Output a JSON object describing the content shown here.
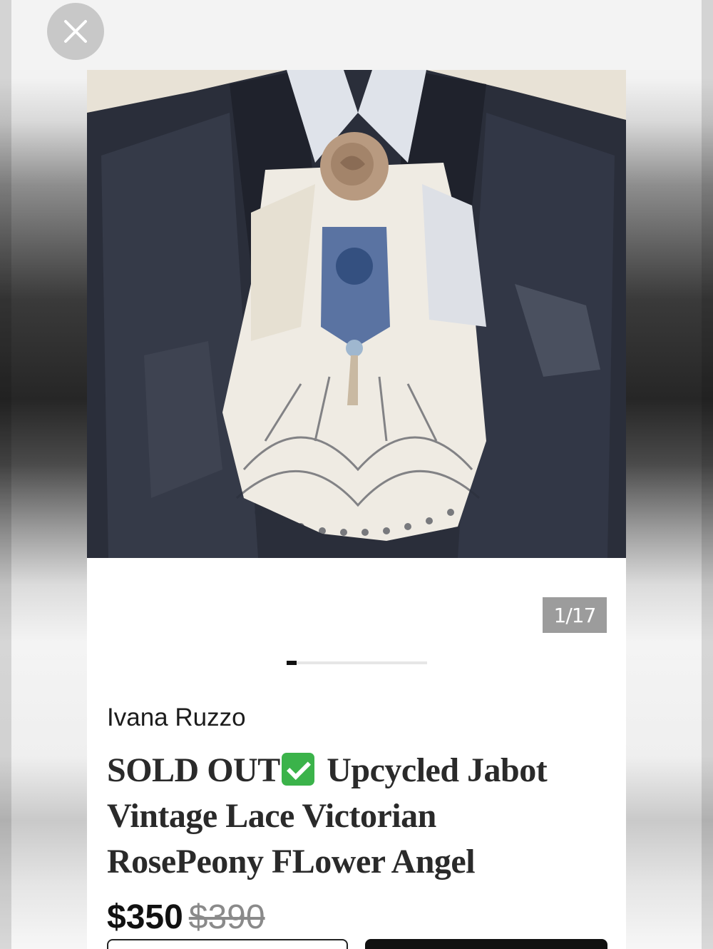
{
  "close": {
    "icon": "close-icon"
  },
  "gallery": {
    "counter": "1/17",
    "progress": 0.07
  },
  "listing": {
    "seller": "Ivana Ruzzo",
    "title_part1": "SOLD OUT",
    "title_part2": " Upcycled Jabot Vintage Lace Victorian RosePeony FLower Angel",
    "price": "$350",
    "original_price": "$390"
  },
  "colors": {
    "checkmark": "#3bb34a",
    "counter_bg": "#9c9c9c"
  }
}
